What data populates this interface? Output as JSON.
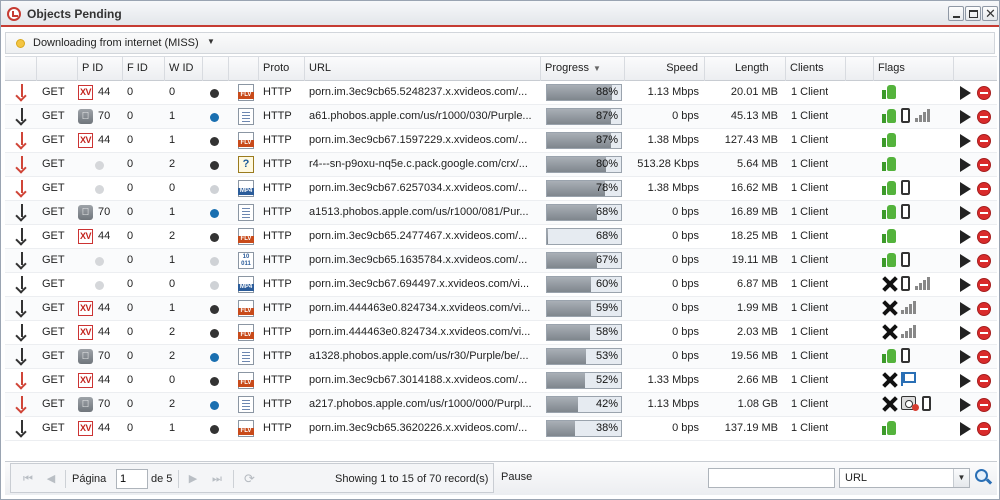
{
  "window": {
    "title": "Objects Pending"
  },
  "status": {
    "text": "Downloading from internet (MISS)"
  },
  "columns": {
    "pid": "P ID",
    "fid": "F ID",
    "wid": "W ID",
    "proto": "Proto",
    "url": "URL",
    "progress": "Progress",
    "speed": "Speed",
    "length": "Length",
    "clients": "Clients",
    "flags": "Flags"
  },
  "rows": [
    {
      "dir": "red",
      "method": "GET",
      "pid_icon": "xv",
      "pid": "44",
      "fid": "0",
      "wid": "0",
      "wstate": "dark",
      "ftype": "flv",
      "proto": "HTTP",
      "url": "porn.im.3ec9cb65.5248237.x.xvideos.com/...",
      "progress": 0.88,
      "progress_text": "88%",
      "speed": "1.13 Mbps",
      "length": "20.01 MB",
      "clients": "1 Client",
      "flags": [
        "thumb"
      ]
    },
    {
      "dir": "dark",
      "method": "GET",
      "pid_icon": "apple",
      "pid": "70",
      "fid": "0",
      "wid": "1",
      "wstate": "blue",
      "ftype": "doc",
      "proto": "HTTP",
      "url": "a61.phobos.apple.com/us/r1000/030/Purple...",
      "progress": 0.87,
      "progress_text": "87%",
      "speed": "0 bps",
      "length": "45.13 MB",
      "clients": "1 Client",
      "flags": [
        "thumb",
        "phone",
        "signal"
      ]
    },
    {
      "dir": "red",
      "method": "GET",
      "pid_icon": "xv",
      "pid": "44",
      "fid": "0",
      "wid": "1",
      "wstate": "dark",
      "ftype": "flv",
      "proto": "HTTP",
      "url": "porn.im.3ec9cb67.1597229.x.xvideos.com/...",
      "progress": 0.87,
      "progress_text": "87%",
      "speed": "1.38 Mbps",
      "length": "127.43 MB",
      "clients": "1 Client",
      "flags": [
        "thumb"
      ]
    },
    {
      "dir": "red",
      "method": "GET",
      "pid_icon": "none",
      "pid": "",
      "fid": "0",
      "wid": "2",
      "wstate": "dark",
      "ftype": "q",
      "proto": "HTTP",
      "url": "r4---sn-p9oxu-nq5e.c.pack.google.com/crx/...",
      "progress": 0.8,
      "progress_text": "80%",
      "speed": "513.28 Kbps",
      "length": "5.64 MB",
      "clients": "1 Client",
      "flags": [
        "thumb"
      ]
    },
    {
      "dir": "red",
      "method": "GET",
      "pid_icon": "none",
      "pid": "",
      "fid": "0",
      "wid": "0",
      "wstate": "grey",
      "ftype": "mp4",
      "proto": "HTTP",
      "url": "porn.im.3ec9cb67.6257034.x.xvideos.com/...",
      "progress": 0.78,
      "progress_text": "78%",
      "speed": "1.38 Mbps",
      "length": "16.62 MB",
      "clients": "1 Client",
      "flags": [
        "thumb",
        "phone"
      ]
    },
    {
      "dir": "dark",
      "method": "GET",
      "pid_icon": "apple",
      "pid": "70",
      "fid": "0",
      "wid": "1",
      "wstate": "blue",
      "ftype": "doc",
      "proto": "HTTP",
      "url": "a1513.phobos.apple.com/us/r1000/081/Pur...",
      "progress": 0.68,
      "progress_text": "68%",
      "speed": "0 bps",
      "length": "16.89 MB",
      "clients": "1 Client",
      "flags": [
        "thumb",
        "phone"
      ]
    },
    {
      "dir": "dark",
      "method": "GET",
      "pid_icon": "xv",
      "pid": "44",
      "fid": "0",
      "wid": "2",
      "wstate": "dark",
      "ftype": "flv",
      "proto": "HTTP",
      "url": "porn.im.3ec9cb65.2477467.x.xvideos.com/...",
      "progress": 0.02,
      "progress_text": "68%",
      "speed": "0 bps",
      "length": "18.25 MB",
      "clients": "1 Client",
      "flags": [
        "thumb"
      ]
    },
    {
      "dir": "dark",
      "method": "GET",
      "pid_icon": "none",
      "pid": "",
      "fid": "0",
      "wid": "1",
      "wstate": "grey",
      "ftype": "bin",
      "proto": "HTTP",
      "url": "porn.im.3ec9cb65.1635784.x.xvideos.com/...",
      "progress": 0.67,
      "progress_text": "67%",
      "speed": "0 bps",
      "length": "19.11 MB",
      "clients": "1 Client",
      "flags": [
        "thumb",
        "phone"
      ]
    },
    {
      "dir": "dark",
      "method": "GET",
      "pid_icon": "none",
      "pid": "",
      "fid": "0",
      "wid": "0",
      "wstate": "grey",
      "ftype": "mp4",
      "proto": "HTTP",
      "url": "porn.im.3ec9cb67.694497.x.xvideos.com/vi...",
      "progress": 0.6,
      "progress_text": "60%",
      "speed": "0 bps",
      "length": "6.87 MB",
      "clients": "1 Client",
      "flags": [
        "x",
        "phone",
        "signal"
      ]
    },
    {
      "dir": "dark",
      "method": "GET",
      "pid_icon": "xv",
      "pid": "44",
      "fid": "0",
      "wid": "1",
      "wstate": "dark",
      "ftype": "flv",
      "proto": "HTTP",
      "url": "porn.im.444463e0.824734.x.xvideos.com/vi...",
      "progress": 0.59,
      "progress_text": "59%",
      "speed": "0 bps",
      "length": "1.99 MB",
      "clients": "1 Client",
      "flags": [
        "x",
        "signal"
      ]
    },
    {
      "dir": "dark",
      "method": "GET",
      "pid_icon": "xv",
      "pid": "44",
      "fid": "0",
      "wid": "2",
      "wstate": "dark",
      "ftype": "flv",
      "proto": "HTTP",
      "url": "porn.im.444463e0.824734.x.xvideos.com/vi...",
      "progress": 0.58,
      "progress_text": "58%",
      "speed": "0 bps",
      "length": "2.03 MB",
      "clients": "1 Client",
      "flags": [
        "x",
        "signal"
      ]
    },
    {
      "dir": "dark",
      "method": "GET",
      "pid_icon": "apple",
      "pid": "70",
      "fid": "0",
      "wid": "2",
      "wstate": "blue",
      "ftype": "doc",
      "proto": "HTTP",
      "url": "a1328.phobos.apple.com/us/r30/Purple/be/...",
      "progress": 0.53,
      "progress_text": "53%",
      "speed": "0 bps",
      "length": "19.56 MB",
      "clients": "1 Client",
      "flags": [
        "thumb",
        "phone"
      ]
    },
    {
      "dir": "red",
      "method": "GET",
      "pid_icon": "xv",
      "pid": "44",
      "fid": "0",
      "wid": "0",
      "wstate": "dark",
      "ftype": "flv",
      "proto": "HTTP",
      "url": "porn.im.3ec9cb67.3014188.x.xvideos.com/...",
      "progress": 0.52,
      "progress_text": "52%",
      "speed": "1.33 Mbps",
      "length": "2.66 MB",
      "clients": "1 Client",
      "flags": [
        "x",
        "bluflag"
      ]
    },
    {
      "dir": "red",
      "method": "GET",
      "pid_icon": "apple",
      "pid": "70",
      "fid": "0",
      "wid": "2",
      "wstate": "blue",
      "ftype": "doc",
      "proto": "HTTP",
      "url": "a217.phobos.apple.com/us/r1000/000/Purpl...",
      "progress": 0.42,
      "progress_text": "42%",
      "speed": "1.13 Mbps",
      "length": "1.08 GB",
      "clients": "1 Client",
      "flags": [
        "x",
        "cam",
        "phone"
      ]
    },
    {
      "dir": "dark",
      "method": "GET",
      "pid_icon": "xv",
      "pid": "44",
      "fid": "0",
      "wid": "1",
      "wstate": "dark",
      "ftype": "flv",
      "proto": "HTTP",
      "url": "porn.im.3ec9cb65.3620226.x.xvideos.com/...",
      "progress": 0.38,
      "progress_text": "38%",
      "speed": "0 bps",
      "length": "137.19 MB",
      "clients": "1 Client",
      "flags": [
        "thumb"
      ]
    }
  ],
  "icons": {
    "xv": "XV",
    "apple": "",
    "flv": "FLV",
    "mp4": "MP4",
    "q": "?",
    "bin": "10 011"
  },
  "footer": {
    "page_label": "Página",
    "page_value": "1",
    "of_label": "de 5",
    "showing": "Showing 1 to 15 of 70 record(s)",
    "pause": "Pause",
    "search_value": "",
    "search_field": "URL"
  },
  "colors": {
    "accent": "#c63b32",
    "status_dot": "#f4c542",
    "progress_fill": "#8a9098",
    "thumb": "#54b33c",
    "stop": "#d92b2b"
  }
}
